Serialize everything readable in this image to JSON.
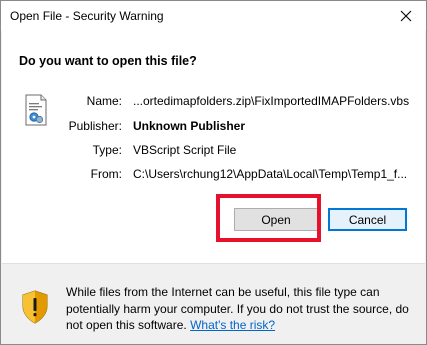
{
  "window": {
    "title": "Open File - Security Warning"
  },
  "dialog": {
    "question": "Do you want to open this file?",
    "fields": [
      {
        "label": "Name:",
        "value": "...ortedimapfolders.zip\\FixImportedIMAPFolders.vbs"
      },
      {
        "label": "Publisher:",
        "value": "Unknown Publisher"
      },
      {
        "label": "Type:",
        "value": "VBScript Script File"
      },
      {
        "label": "From:",
        "value": "C:\\Users\\rchung12\\AppData\\Local\\Temp\\Temp1_f..."
      }
    ]
  },
  "buttons": {
    "open": "Open",
    "cancel": "Cancel"
  },
  "footer": {
    "warning_text": "While files from the Internet can be useful, this file type can potentially harm your computer. If you do not trust the source, do not open this software.",
    "link_text": "What's the risk?"
  },
  "icons": {
    "file": "vbs-script-file-icon",
    "shield": "security-shield-icon",
    "close": "close-icon"
  },
  "colors": {
    "highlight": "#e8112d",
    "default_button_border": "#0078d7",
    "link": "#0066cc"
  }
}
